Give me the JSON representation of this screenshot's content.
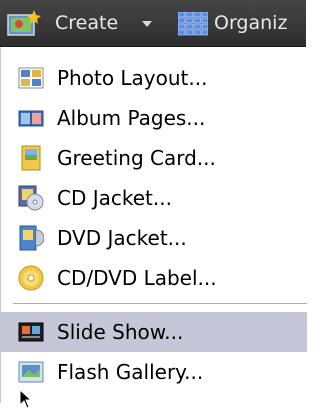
{
  "toolbar": {
    "create_label": "Create",
    "create_icon": "create-wizard-icon",
    "organize_label": "Organiz",
    "organize_icon": "organize-grid-icon"
  },
  "menu": {
    "items": [
      {
        "label": "Photo Layout...",
        "icon": "photo-layout-icon"
      },
      {
        "label": "Album Pages...",
        "icon": "album-pages-icon"
      },
      {
        "label": "Greeting Card...",
        "icon": "greeting-card-icon"
      },
      {
        "label": "CD Jacket...",
        "icon": "cd-jacket-icon"
      },
      {
        "label": "DVD Jacket...",
        "icon": "dvd-jacket-icon"
      },
      {
        "label": "CD/DVD Label...",
        "icon": "cd-dvd-label-icon"
      },
      {
        "label": "Slide Show...",
        "icon": "slide-show-icon",
        "highlighted": true
      },
      {
        "label": "Flash Gallery...",
        "icon": "flash-gallery-icon"
      }
    ]
  },
  "colors": {
    "toolbar_bg": "#3a3a3a",
    "highlight_bg": "#c5c7d9",
    "menu_bg": "#ffffff"
  }
}
